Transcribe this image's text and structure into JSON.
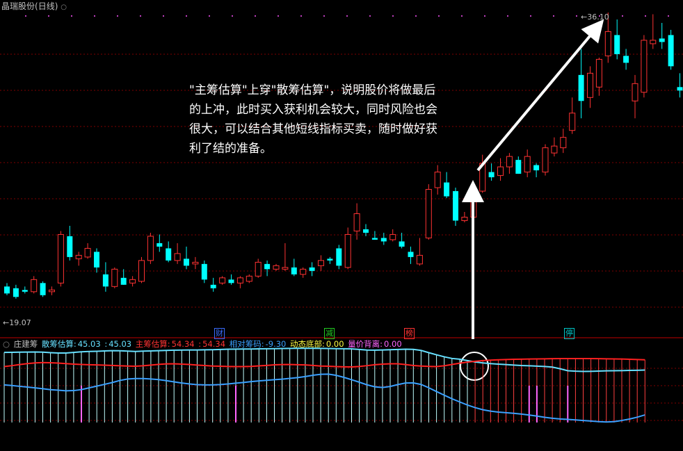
{
  "header": {
    "title": "晶瑞股份",
    "period": "(日线)"
  },
  "annotation": "\"主筹估算\"上穿\"散筹估算\"，说明股价将做最后的上冲，此时买入获利机会较大，同时风险也会很大，可以结合其他短线指标买卖，随时做好获利了结的准备。",
  "price_labels": {
    "high": "36.10",
    "low": "19.07"
  },
  "event_markers": [
    {
      "text": "财",
      "color": "#3a6cff"
    },
    {
      "text": "减",
      "color": "#22cc22"
    },
    {
      "text": "榜",
      "color": "#ff3333"
    },
    {
      "text": "停",
      "color": "#00c8c8"
    }
  ],
  "indicator": {
    "name": "庄建筹",
    "items": [
      {
        "label": "散筹估算:",
        "value": "45.03",
        "color": "#66e0ff"
      },
      {
        "label": ":",
        "value": "45.03",
        "color": "#66e0ff"
      },
      {
        "label": "主筹估算:",
        "value": "54.34",
        "color": "#ff3333"
      },
      {
        "label": ":",
        "value": "54.34",
        "color": "#ff3333"
      },
      {
        "label": "相对筹码:",
        "value": "-9.30",
        "color": "#3aa0ff"
      },
      {
        "label": "动态底部:",
        "value": "0.00",
        "color": "#ffff44"
      },
      {
        "label": "量价背离:",
        "value": "0.00",
        "color": "#ff66ff"
      }
    ]
  },
  "colors": {
    "up": "#ff3232",
    "down": "#00ffff",
    "grid": "#800000",
    "retail": "#66e0ff",
    "main": "#ff2020",
    "relative": "#3aa0ff",
    "spike": "#ff66ff"
  },
  "chart_data": [
    {
      "type": "candlestick",
      "title": "晶瑞股份 (日线)",
      "high_label": 36.1,
      "low_label": 19.07,
      "ohlc": [
        [
          20.3,
          20.5,
          19.8,
          19.9
        ],
        [
          20.2,
          20.4,
          19.6,
          19.7
        ],
        [
          20.1,
          20.3,
          19.9,
          20.0
        ],
        [
          20.0,
          20.9,
          19.9,
          20.7
        ],
        [
          20.5,
          20.6,
          19.7,
          19.8
        ],
        [
          20.0,
          20.3,
          19.8,
          20.1
        ],
        [
          20.5,
          23.5,
          20.3,
          23.3
        ],
        [
          23.2,
          23.8,
          21.8,
          22.0
        ],
        [
          21.9,
          22.3,
          21.5,
          22.1
        ],
        [
          22.0,
          22.8,
          21.9,
          22.5
        ],
        [
          22.3,
          22.5,
          21.1,
          21.4
        ],
        [
          21.0,
          21.7,
          20.0,
          20.3
        ],
        [
          20.3,
          21.4,
          20.2,
          21.3
        ],
        [
          20.8,
          21.3,
          20.4,
          20.4
        ],
        [
          20.5,
          20.9,
          20.3,
          20.7
        ],
        [
          20.6,
          22.0,
          20.5,
          21.8
        ],
        [
          21.8,
          23.4,
          21.6,
          23.2
        ],
        [
          22.8,
          23.3,
          22.3,
          22.6
        ],
        [
          22.5,
          22.9,
          21.7,
          21.8
        ],
        [
          21.8,
          22.8,
          21.6,
          22.2
        ],
        [
          21.9,
          22.6,
          21.3,
          21.5
        ],
        [
          21.6,
          22.0,
          21.3,
          21.7
        ],
        [
          21.6,
          21.8,
          20.5,
          20.7
        ],
        [
          20.4,
          20.8,
          20.0,
          20.2
        ],
        [
          20.5,
          20.9,
          20.4,
          20.8
        ],
        [
          20.7,
          21.0,
          20.4,
          20.5
        ],
        [
          20.5,
          20.9,
          20.2,
          20.8
        ],
        [
          20.6,
          21.0,
          20.5,
          20.9
        ],
        [
          20.9,
          21.9,
          20.8,
          21.7
        ],
        [
          21.6,
          21.8,
          20.9,
          21.3
        ],
        [
          21.3,
          21.6,
          21.2,
          21.5
        ],
        [
          21.3,
          22.8,
          21.2,
          21.4
        ],
        [
          21.4,
          21.9,
          20.9,
          21.0
        ],
        [
          21.0,
          21.4,
          20.8,
          21.3
        ],
        [
          21.4,
          21.7,
          20.9,
          21.2
        ],
        [
          21.5,
          22.1,
          21.2,
          21.8
        ],
        [
          21.9,
          22.0,
          21.6,
          21.8
        ],
        [
          22.5,
          22.7,
          21.3,
          21.5
        ],
        [
          21.4,
          23.7,
          21.3,
          23.3
        ],
        [
          23.5,
          25.1,
          23.0,
          24.5
        ],
        [
          23.6,
          23.9,
          23.2,
          23.4
        ],
        [
          23.1,
          23.5,
          23.0,
          23.0
        ],
        [
          23.1,
          23.4,
          22.7,
          22.9
        ],
        [
          23.0,
          23.6,
          22.9,
          23.3
        ],
        [
          22.9,
          23.4,
          22.5,
          22.6
        ],
        [
          22.3,
          22.6,
          21.6,
          22.0
        ],
        [
          21.6,
          23.1,
          21.5,
          22.1
        ],
        [
          23.1,
          26.2,
          23.0,
          25.9
        ],
        [
          26.0,
          27.3,
          25.6,
          26.9
        ],
        [
          26.3,
          26.9,
          25.4,
          25.5
        ],
        [
          25.8,
          26.0,
          23.8,
          24.1
        ],
        [
          24.1,
          24.6,
          24.0,
          24.3
        ],
        [
          24.3,
          26.0,
          24.1,
          25.8
        ],
        [
          25.8,
          27.9,
          25.7,
          27.4
        ],
        [
          26.9,
          27.4,
          26.4,
          26.6
        ],
        [
          26.7,
          27.7,
          26.4,
          27.2
        ],
        [
          27.2,
          28.0,
          26.8,
          27.8
        ],
        [
          27.6,
          27.8,
          26.8,
          26.8
        ],
        [
          26.9,
          28.2,
          26.6,
          27.8
        ],
        [
          27.3,
          27.4,
          26.6,
          27.0
        ],
        [
          26.9,
          28.5,
          26.7,
          28.3
        ],
        [
          28.0,
          28.9,
          27.8,
          28.4
        ],
        [
          28.3,
          29.4,
          28.0,
          28.9
        ],
        [
          29.3,
          31.2,
          29.1,
          30.3
        ],
        [
          32.5,
          34.0,
          30.0,
          31.0
        ],
        [
          31.2,
          33.0,
          30.6,
          32.6
        ],
        [
          31.8,
          33.5,
          31.3,
          33.4
        ],
        [
          33.6,
          36.1,
          33.2,
          35.0
        ],
        [
          34.8,
          35.7,
          33.4,
          33.7
        ],
        [
          33.6,
          34.0,
          32.8,
          33.2
        ],
        [
          31.0,
          32.5,
          30.0,
          32.0
        ],
        [
          31.5,
          34.8,
          31.2,
          34.5
        ],
        [
          34.3,
          36.0,
          34.0,
          34.5
        ],
        [
          34.6,
          35.5,
          34.0,
          34.4
        ],
        [
          34.8,
          35.1,
          32.8,
          33.0
        ],
        [
          31.8,
          32.6,
          31.2,
          31.6
        ]
      ]
    },
    {
      "type": "line",
      "title": "庄建筹",
      "series": [
        {
          "name": "散筹估算",
          "values": [
            60.5,
            60.6,
            60.7,
            60.8,
            60.9,
            60.7,
            60.3,
            60.0,
            60.0,
            60.5,
            61.0,
            61.3,
            61.5,
            61.8,
            62.0,
            61.9,
            61.6,
            61.3,
            61.6,
            61.8,
            62.0,
            62.2,
            62.4,
            62.5,
            62.6,
            62.6,
            62.7,
            62.8,
            63.0,
            63.2,
            63.3,
            63.4,
            63.4,
            63.5,
            63.6,
            63.7,
            63.8,
            63.9,
            64.0,
            64.0,
            64.0,
            63.9,
            63.8,
            63.7,
            63.6,
            63.5,
            63.0,
            62.5,
            62.4,
            62.6,
            62.8,
            63.0,
            63.2,
            63.1,
            62.2,
            60.3,
            58.5,
            56.8,
            55.4,
            54.8,
            53.6,
            52.4,
            51.6,
            51.0,
            50.6,
            50.2,
            49.8,
            49.4,
            49.2,
            48.9,
            48.6,
            48.1,
            46.7,
            45.0,
            44.6,
            44.4,
            44.5,
            44.7,
            44.9,
            45.0,
            45.1,
            45.3,
            45.4,
            45.6
          ]
        },
        {
          "name": "主筹估算",
          "values": [
            48.5,
            49.3,
            50.2,
            51.0,
            51.6,
            51.9,
            51.8,
            51.5,
            51.0,
            50.6,
            50.3,
            50.1,
            49.9,
            49.7,
            49.5,
            49.2,
            49.0,
            48.8,
            49.2,
            49.8,
            50.4,
            50.8,
            50.9,
            50.6,
            50.3,
            49.8,
            49.4,
            49.0,
            48.8,
            48.6,
            48.5,
            48.5,
            48.7,
            49.1,
            49.5,
            50.0,
            50.2,
            50.3,
            50.1,
            49.9,
            49.5,
            49.0,
            48.8,
            48.5,
            48.3,
            48.2,
            48.6,
            49.3,
            50.1,
            50.6,
            50.9,
            50.9,
            50.2,
            49.4,
            49.0,
            48.7,
            48.5,
            49.2,
            50.3,
            51.4,
            52.3,
            53.0,
            53.6,
            54.0,
            54.3,
            54.5,
            54.7,
            54.8,
            54.9,
            55.0,
            55.1,
            55.2,
            55.3,
            55.3,
            55.3,
            55.3,
            55.3,
            55.2,
            55.1,
            55.0,
            54.9,
            54.7,
            54.5,
            54.3
          ]
        },
        {
          "name": "相对筹码",
          "values": [
            33.0,
            32.5,
            31.8,
            31.2,
            30.5,
            29.8,
            29.0,
            28.5,
            28.0,
            28.2,
            29.0,
            30.5,
            32.0,
            33.5,
            35.0,
            36.8,
            38.0,
            38.4,
            38.4,
            38.0,
            37.5,
            36.6,
            35.6,
            34.6,
            33.8,
            33.2,
            33.0,
            33.0,
            33.3,
            33.8,
            34.5,
            35.1,
            35.8,
            36.4,
            36.9,
            37.4,
            37.9,
            38.5,
            39.2,
            40.1,
            41.2,
            42.0,
            42.1,
            41.1,
            39.4,
            37.4,
            35.3,
            33.1,
            31.4,
            30.8,
            31.7,
            33.3,
            34.6,
            34.7,
            33.4,
            30.6,
            27.4,
            24.3,
            21.3,
            18.6,
            16.0,
            13.8,
            12.0,
            10.8,
            10.0,
            9.5,
            9.0,
            8.3,
            7.5,
            6.6,
            5.6,
            4.8,
            4.2,
            3.8,
            3.4,
            2.9,
            2.4,
            1.9,
            1.6,
            1.9,
            2.9,
            4.1,
            5.7,
            7.6
          ]
        },
        {
          "name": "量价背离",
          "type": "bar",
          "values": [
            0,
            0,
            0,
            0,
            0,
            0,
            0,
            0,
            0,
            0,
            0,
            0,
            0,
            0,
            0,
            0,
            0,
            0,
            0,
            0,
            0,
            0,
            0,
            0,
            0,
            0,
            0,
            0,
            0,
            0,
            0,
            0,
            0,
            0,
            0,
            0,
            0,
            0,
            0,
            0,
            0,
            0,
            0,
            0,
            0,
            0,
            0,
            0,
            0,
            0,
            0,
            0,
            0,
            0,
            0,
            0,
            0,
            0,
            0,
            0,
            0,
            0,
            0,
            0,
            0,
            0,
            0,
            0,
            0,
            0,
            0,
            0,
            0,
            0,
            0,
            0,
            0,
            0,
            0,
            0,
            0,
            0,
            0,
            0
          ]
        }
      ]
    }
  ]
}
